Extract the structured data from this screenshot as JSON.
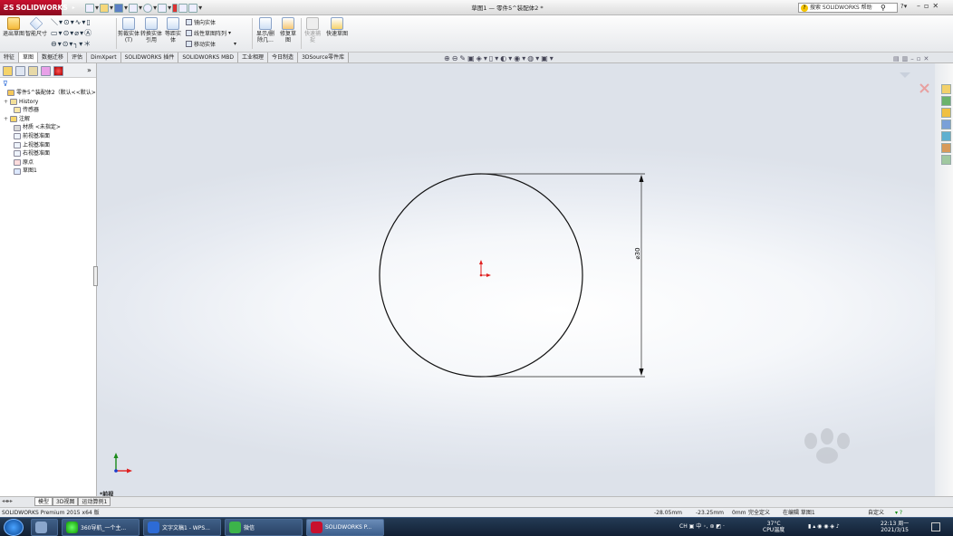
{
  "app": {
    "logo_text": "SOLIDWORKS",
    "document_title": "草图1 — 零件5^装配体2 *"
  },
  "search": {
    "placeholder": "搜索 SOLIDWORKS 帮助"
  },
  "ribbon": {
    "exit_sketch": "退出草图",
    "smart_dimension": "智能尺寸",
    "trim_entities": "剪裁实体(T)",
    "convert_entities": "转换实体引用",
    "offset_entities": "等距实体",
    "mirror_entities": "镜向实体",
    "linear_pattern": "线性草图阵列",
    "move_entities": "移动实体",
    "display_delete_relations": "显示/删除几...",
    "repair_sketch": "修复草图",
    "quick_snaps": "快速捕捉",
    "rapid_sketch": "快速草图"
  },
  "cmd_tabs": [
    "特征",
    "草图",
    "数据迁移",
    "评估",
    "DimXpert",
    "SOLIDWORKS 插件",
    "SOLIDWORKS MBD",
    "工业相理",
    "今日制造",
    "3DSource零件库"
  ],
  "feature_tree": {
    "root": "零件5^装配体2（默认<<默认>",
    "items": [
      "History",
      "传感器",
      "注解",
      "材质 <未指定>",
      "前视基准面",
      "上视基准面",
      "右视基准面",
      "原点",
      "草图1"
    ]
  },
  "sketch": {
    "dimension_label": "⌀30",
    "view_label": "*前视"
  },
  "bottom_tabs": [
    "模型",
    "3D视图",
    "运动算例1"
  ],
  "status": {
    "product": "SOLIDWORKS Premium 2015 x64 版",
    "x": "-28.05mm",
    "y": "-23.25mm",
    "z": "0mm",
    "state": "完全定义",
    "editing": "在编辑 草图1",
    "custom": "自定义"
  },
  "taskbar": {
    "items": [
      "360导航_一个主...",
      "文字文稿1 - WPS...",
      "微信",
      "SOLIDWORKS P..."
    ],
    "tray_lang": "中",
    "temp": "37°C",
    "temp_label": "CPU温度",
    "time": "22:13 周一",
    "date": "2021/3/15"
  },
  "colors": {
    "brand_red": "#c8102e",
    "sketch_line": "#111111",
    "origin": "#e02020",
    "triad_y": "#1a8a1a",
    "triad_z": "#1a3acc"
  }
}
